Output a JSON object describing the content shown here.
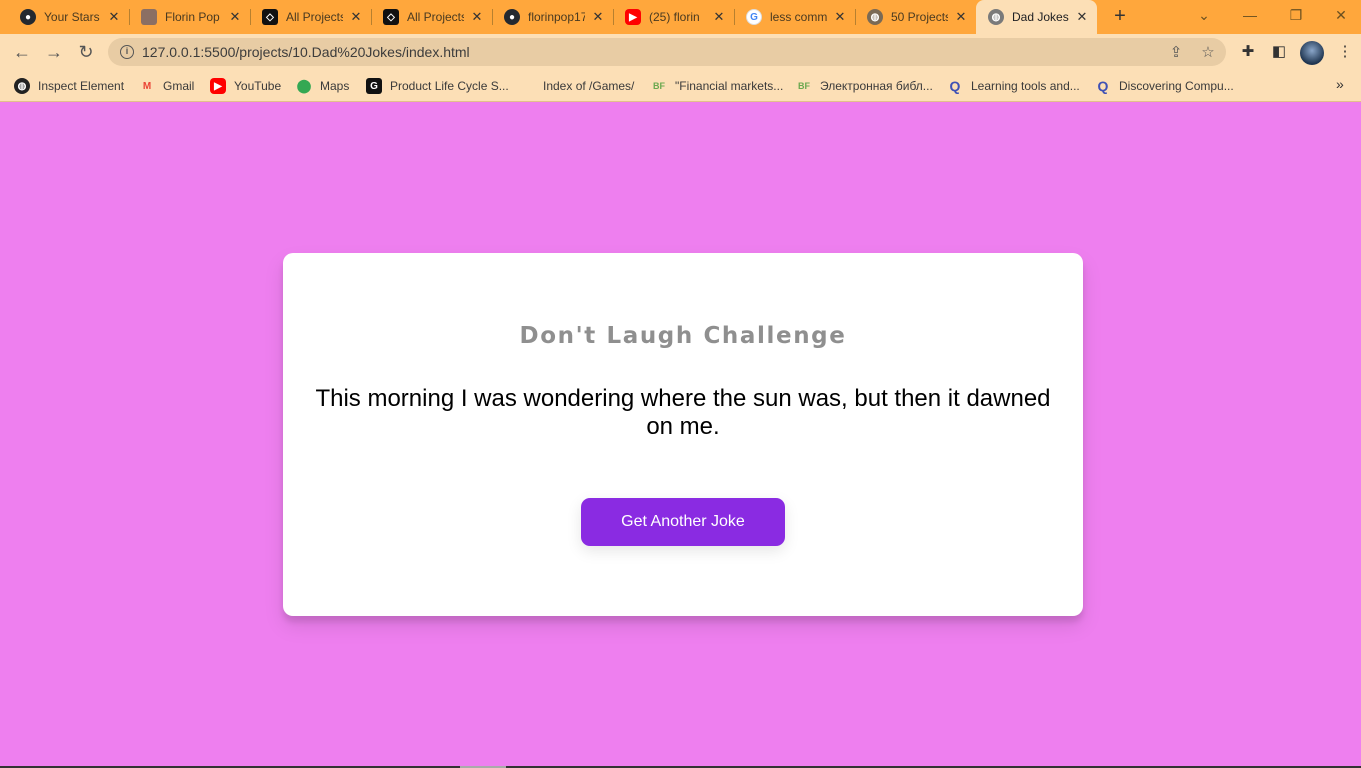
{
  "tabs": [
    {
      "title": "Your Stars",
      "icon": "github-icon"
    },
    {
      "title": "Florin Pop",
      "icon": "avatar-icon"
    },
    {
      "title": "All Projects",
      "icon": "codepen-icon"
    },
    {
      "title": "All Projects",
      "icon": "codepen-icon"
    },
    {
      "title": "florinpop17",
      "icon": "github-icon"
    },
    {
      "title": "(25) florin",
      "icon": "youtube-icon"
    },
    {
      "title": "less comm",
      "icon": "google-icon"
    },
    {
      "title": "50 Projects",
      "icon": "globe-icon"
    },
    {
      "title": "Dad Jokes",
      "icon": "globe-icon",
      "active": true
    }
  ],
  "address_bar": {
    "url": "127.0.0.1:5500/projects/10.Dad%20Jokes/index.html"
  },
  "bookmarks": [
    {
      "label": "Inspect Element",
      "icon": "globe-icon"
    },
    {
      "label": "Gmail",
      "icon": "gmail-icon"
    },
    {
      "label": "YouTube",
      "icon": "youtube-icon"
    },
    {
      "label": "Maps",
      "icon": "maps-icon"
    },
    {
      "label": "Product Life Cycle S...",
      "icon": "g-icon"
    },
    {
      "label": "Index of /Games/",
      "icon": "blank-icon"
    },
    {
      "label": "\"Financial markets...",
      "icon": "bf-icon"
    },
    {
      "label": "Электронная библ...",
      "icon": "bf-icon"
    },
    {
      "label": "Learning tools and...",
      "icon": "q-icon"
    },
    {
      "label": "Discovering Compu...",
      "icon": "q-icon"
    }
  ],
  "page": {
    "heading": "Don't Laugh Challenge",
    "joke": "This morning I was wondering where the sun was, but then it dawned on me.",
    "button_label": "Get Another Joke"
  },
  "colors": {
    "page_background": "#ee7fef",
    "button": "#8a2be2",
    "tab_strip": "#ffa73c",
    "toolbar": "#fcdfb6"
  }
}
